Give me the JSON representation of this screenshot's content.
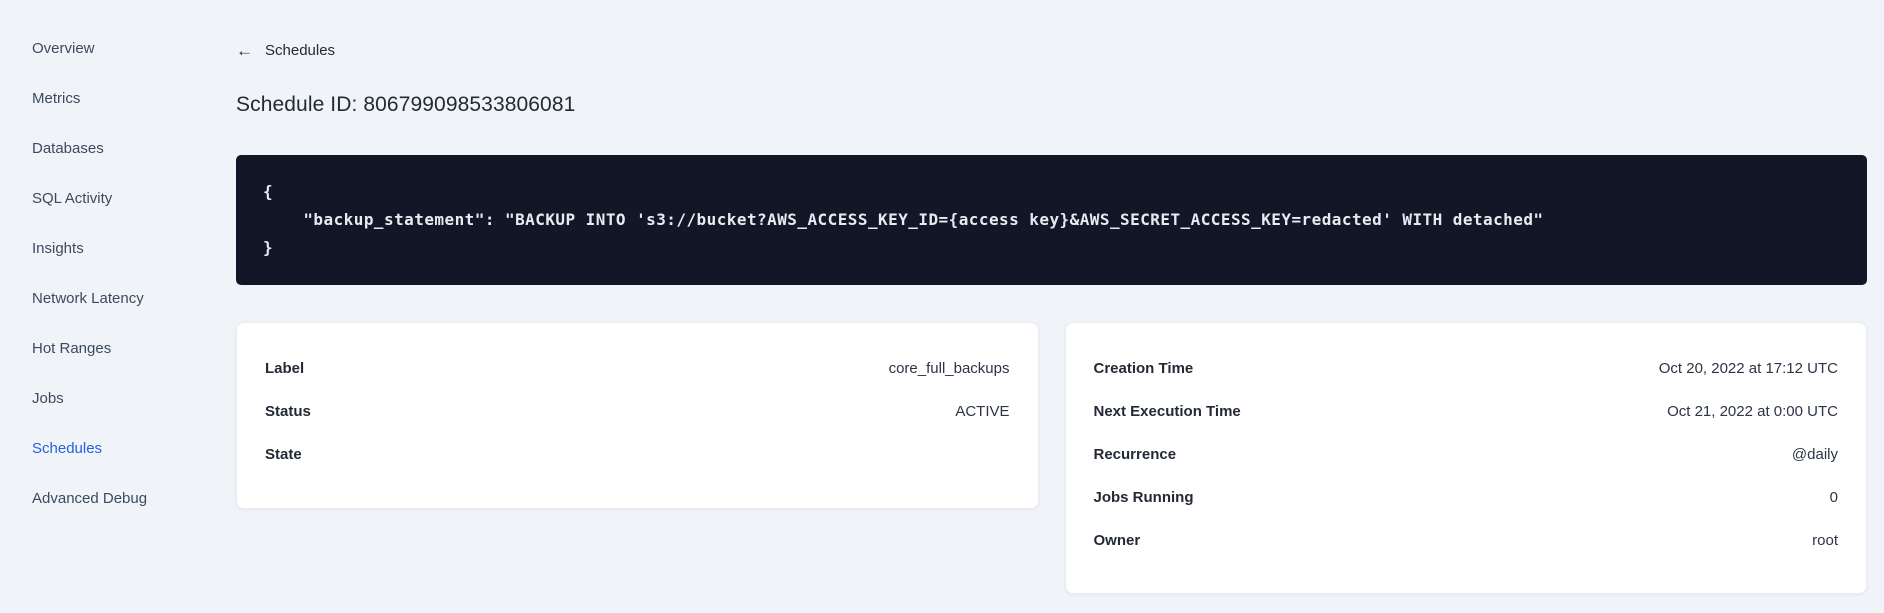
{
  "sidebar": {
    "items": [
      {
        "label": "Overview",
        "active": false
      },
      {
        "label": "Metrics",
        "active": false
      },
      {
        "label": "Databases",
        "active": false
      },
      {
        "label": "SQL Activity",
        "active": false
      },
      {
        "label": "Insights",
        "active": false
      },
      {
        "label": "Network Latency",
        "active": false
      },
      {
        "label": "Hot Ranges",
        "active": false
      },
      {
        "label": "Jobs",
        "active": false
      },
      {
        "label": "Schedules",
        "active": true
      },
      {
        "label": "Advanced Debug",
        "active": false
      }
    ]
  },
  "header": {
    "back_arrow": "←",
    "back_link": "Schedules",
    "title": "Schedule ID: 806799098533806081"
  },
  "code_block": {
    "lines": [
      "{",
      "    \"backup_statement\": \"BACKUP INTO 's3://bucket?AWS_ACCESS_KEY_ID={access key}&AWS_SECRET_ACCESS_KEY=redacted' WITH detached\"",
      "}"
    ]
  },
  "details_card": {
    "rows": [
      {
        "label": "Label",
        "value": "core_full_backups"
      },
      {
        "label": "Status",
        "value": "ACTIVE"
      },
      {
        "label": "State",
        "value": ""
      }
    ]
  },
  "schedule_card": {
    "rows": [
      {
        "label": "Creation Time",
        "value": "Oct 20, 2022 at 17:12 UTC"
      },
      {
        "label": "Next Execution Time",
        "value": "Oct 21, 2022 at 0:00 UTC"
      },
      {
        "label": "Recurrence",
        "value": "@daily"
      },
      {
        "label": "Jobs Running",
        "value": "0"
      },
      {
        "label": "Owner",
        "value": "root"
      }
    ]
  },
  "colors": {
    "background": "#f0f4f8",
    "accent_active_link": "#2760e4",
    "code_block_background": "#111726",
    "code_block_text": "#e7ebf1",
    "card_background": "#ffffff",
    "text_primary": "#242a35"
  }
}
